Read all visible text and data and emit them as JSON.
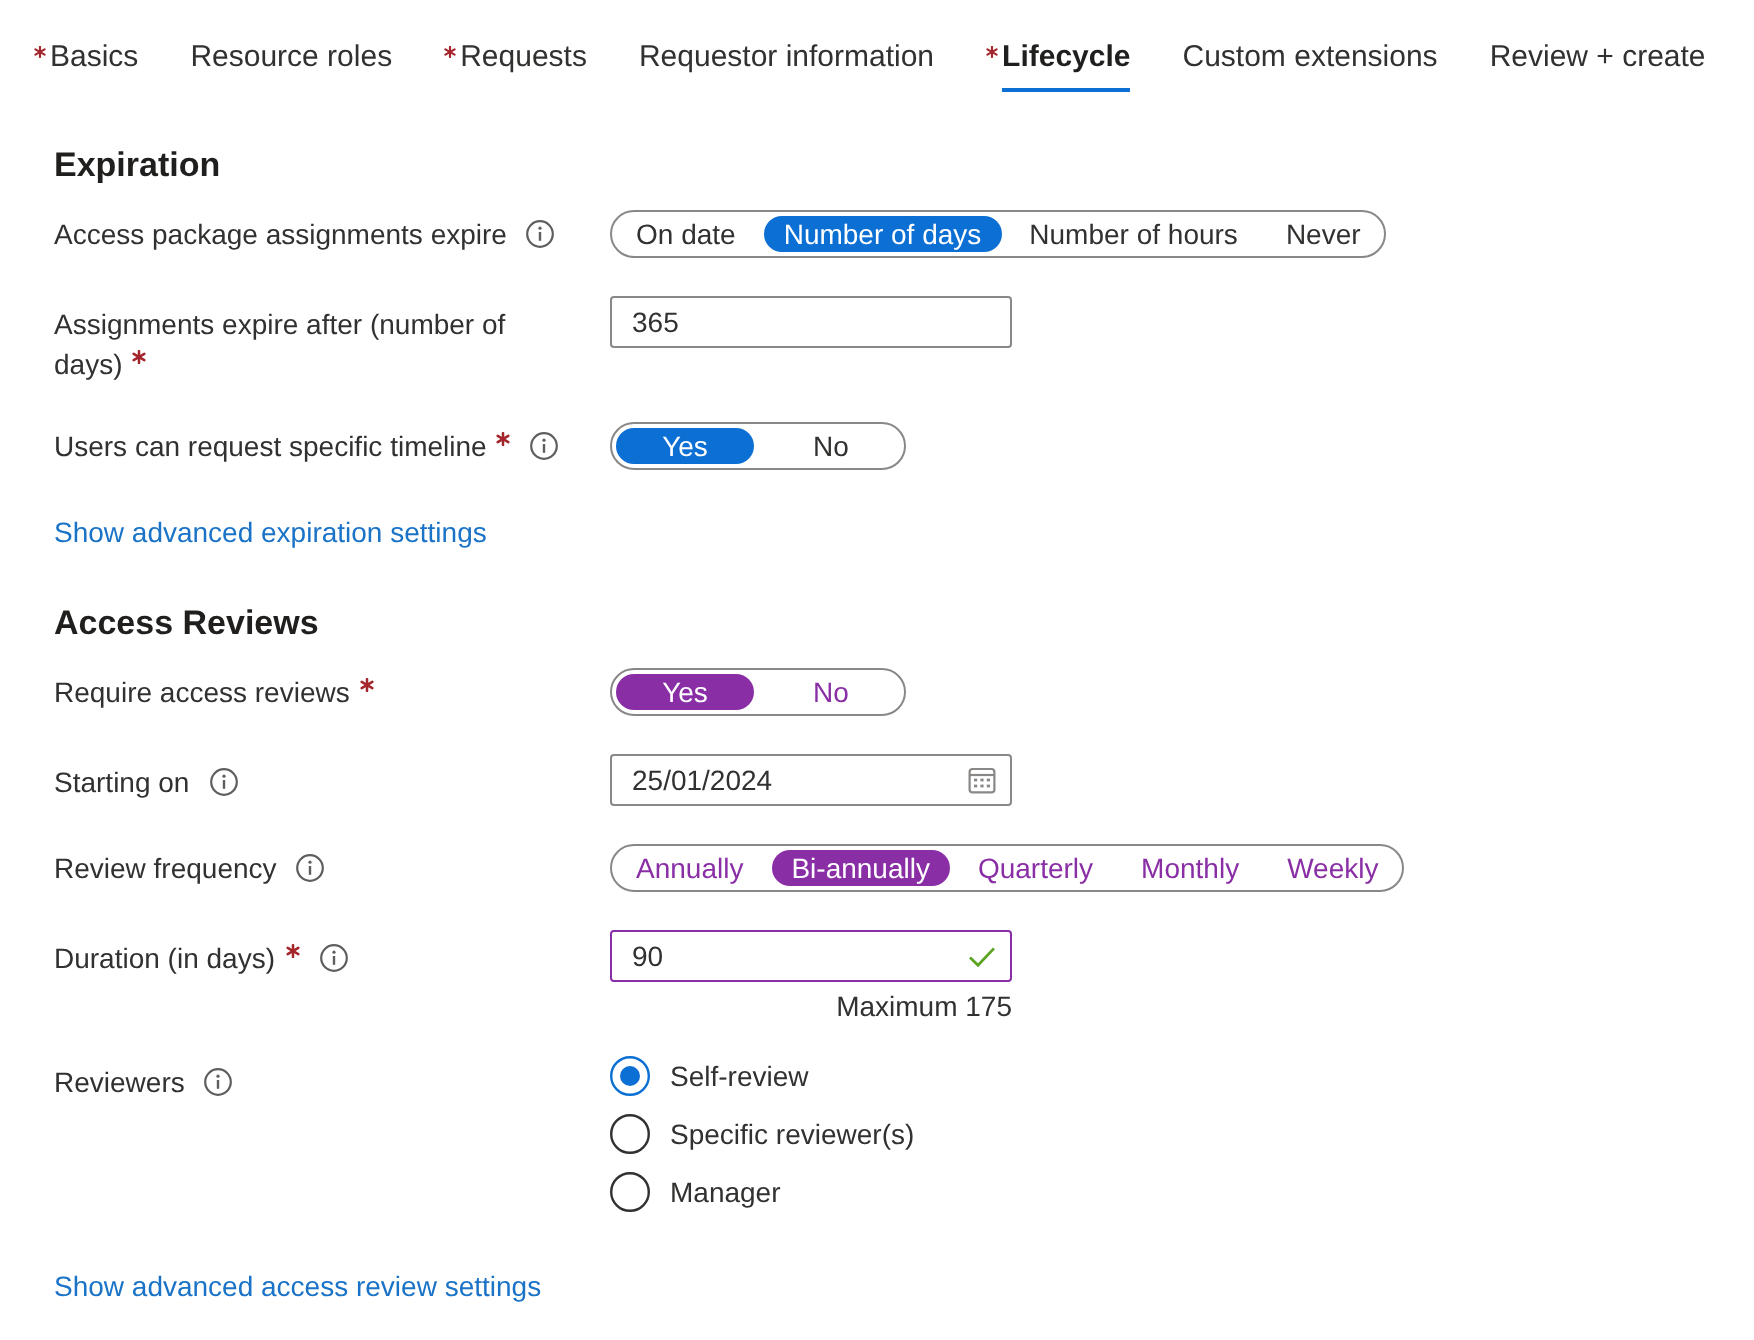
{
  "tabs": [
    {
      "label": "Basics",
      "required": true,
      "selected": false
    },
    {
      "label": "Resource roles",
      "required": false,
      "selected": false
    },
    {
      "label": "Requests",
      "required": true,
      "selected": false
    },
    {
      "label": "Requestor information",
      "required": false,
      "selected": false
    },
    {
      "label": "Lifecycle",
      "required": true,
      "selected": true
    },
    {
      "label": "Custom extensions",
      "required": false,
      "selected": false
    },
    {
      "label": "Review + create",
      "required": false,
      "selected": false
    }
  ],
  "sections": [
    {
      "title": "Expiration",
      "color": "#0b6fd4",
      "highlighted": false,
      "fields": [
        {
          "kind": "segmented",
          "label": "Access package assignments expire",
          "required": false,
          "info": true,
          "options": [
            {
              "label": "On date",
              "selected": false
            },
            {
              "label": "Number of days",
              "selected": true
            },
            {
              "label": "Number of hours",
              "selected": false
            },
            {
              "label": "Never",
              "selected": false
            }
          ]
        },
        {
          "kind": "text",
          "label": "Assignments expire after (number of days)",
          "required": true,
          "info": false,
          "value": "365",
          "focused": false
        },
        {
          "kind": "toggle",
          "label": "Users can request specific timeline",
          "required": true,
          "info": true,
          "options": [
            {
              "label": "Yes",
              "selected": true
            },
            {
              "label": "No",
              "selected": false
            }
          ]
        }
      ],
      "link": "Show advanced expiration settings"
    },
    {
      "title": "Access Reviews",
      "color": "#8a2ea6",
      "highlighted": true,
      "fields": [
        {
          "kind": "toggle",
          "label": "Require access reviews",
          "required": true,
          "info": false,
          "options": [
            {
              "label": "Yes",
              "selected": true
            },
            {
              "label": "No",
              "selected": false
            }
          ]
        },
        {
          "kind": "date",
          "label": "Starting on",
          "required": false,
          "info": true,
          "value": "25/01/2024",
          "focused": false
        },
        {
          "kind": "segmented",
          "label": "Review frequency",
          "required": false,
          "info": true,
          "options": [
            {
              "label": "Annually",
              "selected": false
            },
            {
              "label": "Bi-annually",
              "selected": true
            },
            {
              "label": "Quarterly",
              "selected": false
            },
            {
              "label": "Monthly",
              "selected": false
            },
            {
              "label": "Weekly",
              "selected": false
            }
          ]
        },
        {
          "kind": "text",
          "label": "Duration (in days)",
          "required": true,
          "info": true,
          "value": "90",
          "focused": true,
          "valid": true,
          "hint": "Maximum 175"
        },
        {
          "kind": "radio",
          "label": "Reviewers",
          "required": false,
          "info": true,
          "options": [
            {
              "label": "Self-review",
              "selected": true
            },
            {
              "label": "Specific reviewer(s)",
              "selected": false
            },
            {
              "label": "Manager",
              "selected": false
            }
          ]
        }
      ],
      "link": "Show advanced access review settings"
    }
  ]
}
